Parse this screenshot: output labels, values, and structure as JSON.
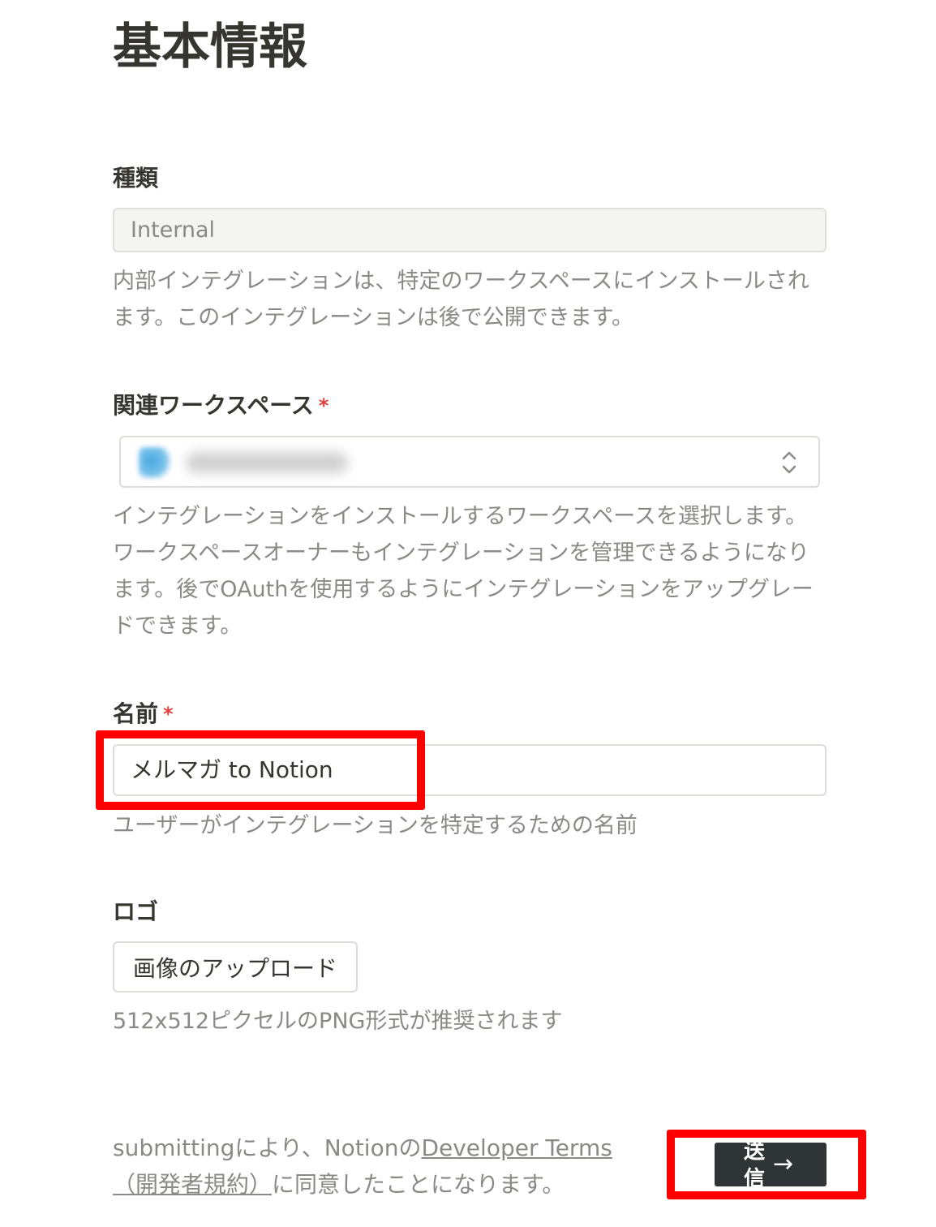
{
  "page": {
    "title": "基本情報"
  },
  "type_section": {
    "label": "種類",
    "value": "Internal",
    "help": "内部インテグレーションは、特定のワークスペースにインストールされます。このインテグレーションは後で公開できます。"
  },
  "workspace_section": {
    "label": "関連ワークスペース",
    "required_mark": "*",
    "help": "インテグレーションをインストールするワークスペースを選択します。ワークスペースオーナーもインテグレーションを管理できるようになります。後でOAuthを使用するようにインテグレーションをアップグレードできます。"
  },
  "name_section": {
    "label": "名前",
    "required_mark": "*",
    "value": "メルマガ to Notion",
    "help": "ユーザーがインテグレーションを特定するための名前"
  },
  "logo_section": {
    "label": "ロゴ",
    "upload_label": "画像のアップロード",
    "help": "512x512ピクセルのPNG形式が推奨されます"
  },
  "footer": {
    "prefix": "submittingにより、Notionの",
    "link_label": "Developer Terms（開発者規約）",
    "suffix": "に同意したことになります。"
  },
  "submit": {
    "label": "送信",
    "arrow": "→"
  },
  "colors": {
    "highlight": "#ff0000",
    "button_bg": "#2f3437",
    "required": "#e03e3e"
  }
}
